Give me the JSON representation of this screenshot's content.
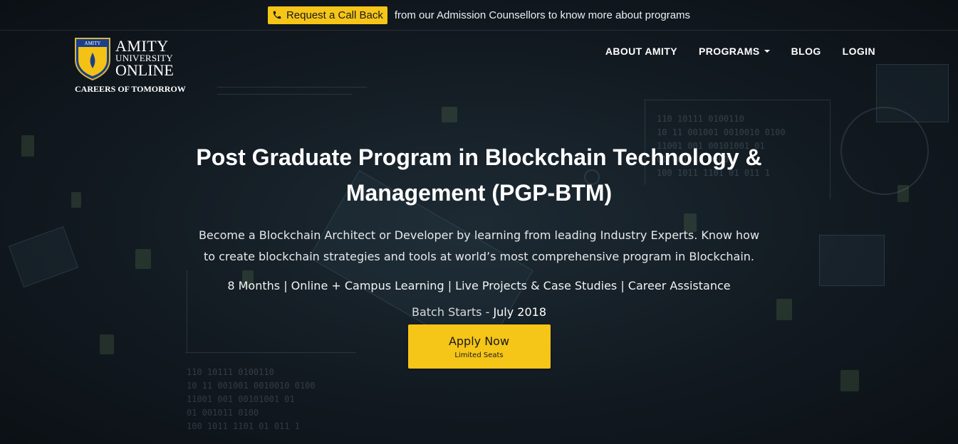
{
  "topbar": {
    "callback_label": "Request a Call Back",
    "callback_icon": "phone-icon",
    "message": "from our Admission Counsellors to know more about programs",
    "accent": "#f5c518"
  },
  "logo": {
    "line1": "AMITY",
    "line2": "UNIVERSITY",
    "line3": "ONLINE",
    "tagline": "CAREERS OF TOMORROW",
    "shield_text": "AMITY"
  },
  "nav": {
    "items": [
      {
        "label": "ABOUT AMITY"
      },
      {
        "label": "PROGRAMS"
      },
      {
        "label": "BLOG"
      },
      {
        "label": "LOGIN"
      }
    ]
  },
  "hero": {
    "title": "Post Graduate Program in Blockchain Technology & Management (PGP-BTM)",
    "description": "Become a Blockchain Architect or Developer by learning from leading Industry Experts. Know how to create blockchain strategies and tools at world’s most comprehensive program in Blockchain.",
    "features": "8 Months | Online + Campus Learning | Live Projects & Case Studies | Career Assistance",
    "batch_label": "Batch Starts - ",
    "batch_date": "July 2018",
    "apply_label": "Apply Now",
    "apply_sub": "Limited Seats"
  },
  "background": {
    "binary_left": "110 10111 0100110\n10 11 001001 0010010 0100\n11001 001 00101001 01\n01 001011 0100\n100 1011 1101 01 011 1",
    "binary_right": "110 10111 0100110\n10 11 001001 0010010 0100\n11001 001 00101001 01\n01 001011 0100\n100 1011 1101 01 011 1"
  }
}
